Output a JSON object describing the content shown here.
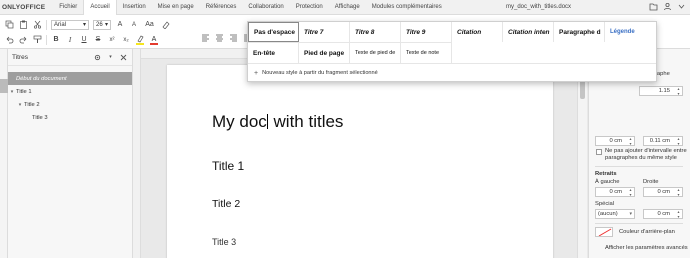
{
  "app": {
    "brand": "ONLYOFFICE",
    "doc_name": "my_doc_with_titles.docx"
  },
  "menu": {
    "tabs": [
      {
        "label": "Fichier"
      },
      {
        "label": "Accueil"
      },
      {
        "label": "Insertion"
      },
      {
        "label": "Mise en page"
      },
      {
        "label": "Références"
      },
      {
        "label": "Collaboration"
      },
      {
        "label": "Protection"
      },
      {
        "label": "Affichage"
      },
      {
        "label": "Modules complémentaires"
      }
    ],
    "active_tab": "Accueil"
  },
  "toolbar": {
    "font_name": "Arial",
    "font_size": "26",
    "grow": "A",
    "shrink": "A",
    "case": "Aa",
    "bold": "B",
    "italic": "I",
    "underline": "U",
    "strike": "S",
    "superscript": "x²",
    "subscript": "x₂",
    "highlight_color": "#f5e51e",
    "font_color": "#e33b2e",
    "paragraph_mark": "¶"
  },
  "navigation": {
    "title": "Titres",
    "items": [
      {
        "label": "Début du document",
        "level": 0
      },
      {
        "label": "Title 1",
        "level": 1
      },
      {
        "label": "Title 2",
        "level": 2
      },
      {
        "label": "Title 3",
        "level": 3
      }
    ]
  },
  "document": {
    "title_before_caret": "My doc",
    "title_after_caret": " with titles",
    "title_1": "Title 1",
    "title_2": "Title 2",
    "title_3": "Title 3"
  },
  "style_gallery": {
    "row1": [
      "Pas d'espace",
      "Titre 7",
      "Titre 8",
      "Titre 9",
      "Citation",
      "Citation inten",
      "Paragraphe d",
      "Légende"
    ],
    "row2": [
      "En-tête",
      "Pied de page",
      "Texte de pied de",
      "Texte de note"
    ],
    "new_style_label": "Nouveau style à partir du fragment sélectionné"
  },
  "paragraph_settings": {
    "line_spacing_value": "1.15",
    "spacing_label_partial": "raphe",
    "before_value": "0 cm",
    "after_value": "0.11 cm",
    "no_space_label_line1": "Ne pas ajouter d'intervalle entre",
    "no_space_label_line2": "paragraphes du même style",
    "indents_label": "Retraits",
    "left_label": "À gauche",
    "right_label": "Droite",
    "left_value": "0 cm",
    "right_value": "0 cm",
    "special_label": "Spécial",
    "special_value": "(aucun)",
    "special_amount": "0 cm",
    "background_color_label": "Couleur d'arrière-plan",
    "advanced_label": "Afficher les paramètres avancés"
  }
}
